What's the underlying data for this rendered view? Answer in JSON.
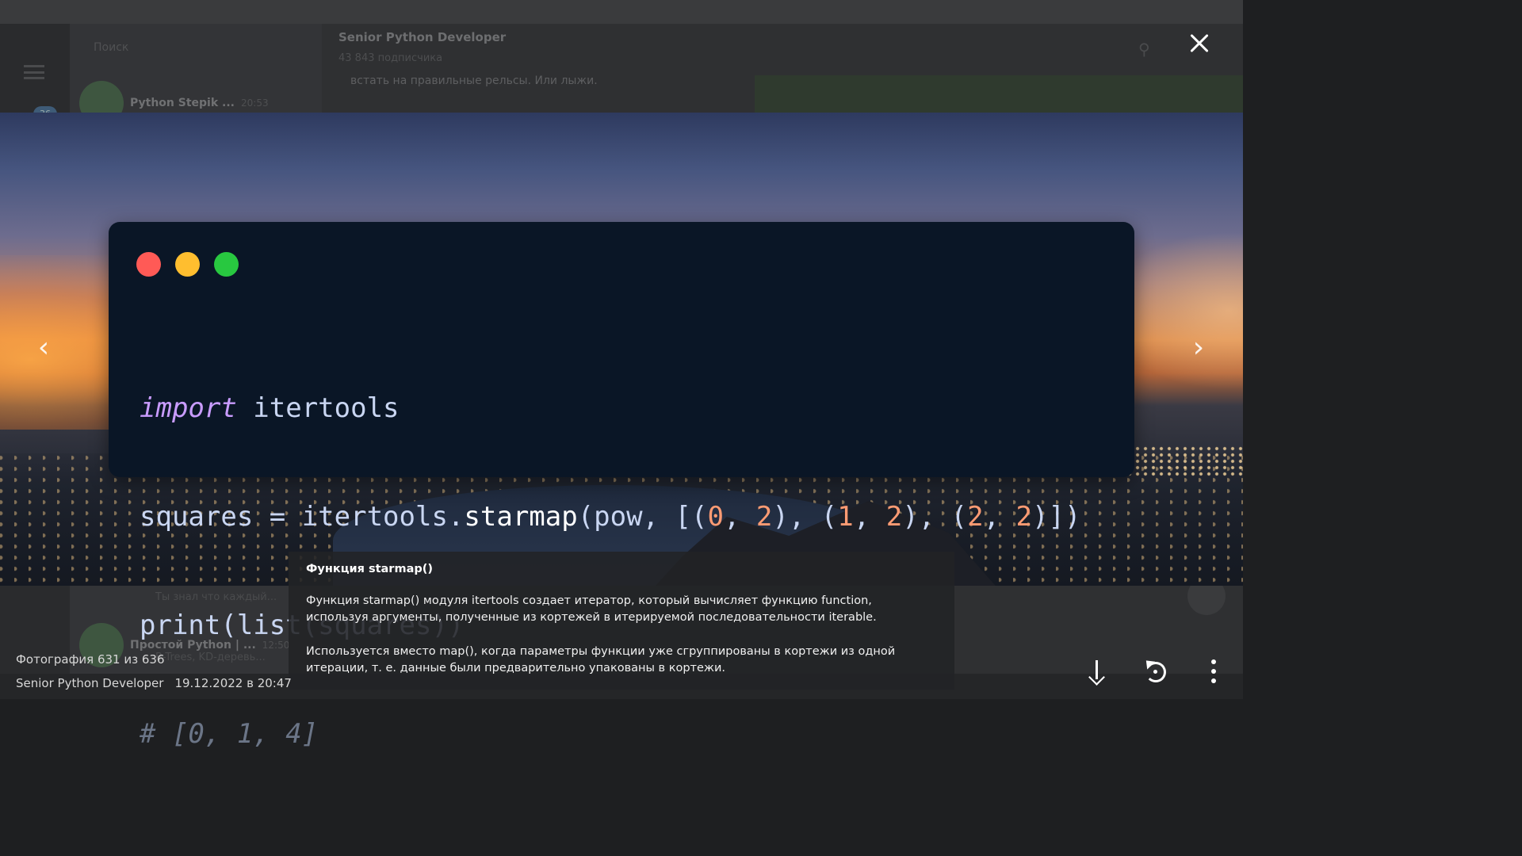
{
  "background": {
    "channel_title": "Senior Python Developer",
    "channel_subscribers": "43 843 подписчика",
    "search_placeholder": "Поиск",
    "unread_badge": "36",
    "message_snippet": "встать на правильные рельсы. Или лыжи.",
    "chats": [
      {
        "name": "Python Stepik ...",
        "time": "20:53",
        "preview": ""
      },
      {
        "name": "",
        "time": "",
        "preview": "Ты знал что каждый..."
      },
      {
        "name": "Простой Python | ...",
        "time": "12:50",
        "preview": "B-Trees, KD-деревь..."
      }
    ]
  },
  "viewer": {
    "close_icon": "close-icon",
    "prev_icon": "chevron-left-icon",
    "next_icon": "chevron-right-icon",
    "prev_glyph": "‹",
    "next_glyph": "›",
    "counter": "Фотография 631 из 636",
    "source": "Senior Python Developer",
    "date": "19.12.2022 в 20:47",
    "actions": [
      "download-icon",
      "rotate-icon",
      "more-menu-icon"
    ]
  },
  "photo": {
    "window_dots": [
      "#ff5a56",
      "#ffbe2f",
      "#28c840"
    ],
    "code_lines": [
      "import itertools",
      "squares = itertools.starmap(pow, [(0, 2), (1, 2), (2, 2)])",
      "print(list(squares))",
      "# [0, 1, 4]"
    ]
  },
  "caption": {
    "title": "Функция starmap()",
    "paragraph_1": "Функция starmap() модуля itertools создает итератор, который вычисляет функцию function, используя аргументы, полученные из кортежей в итерируемой последовательности iterable.",
    "paragraph_2": "Используется вместо map(), когда параметры функции уже сгруппированы в кортежи из одной итерации, т. е. данные были предварительно упакованы в кортежи."
  }
}
